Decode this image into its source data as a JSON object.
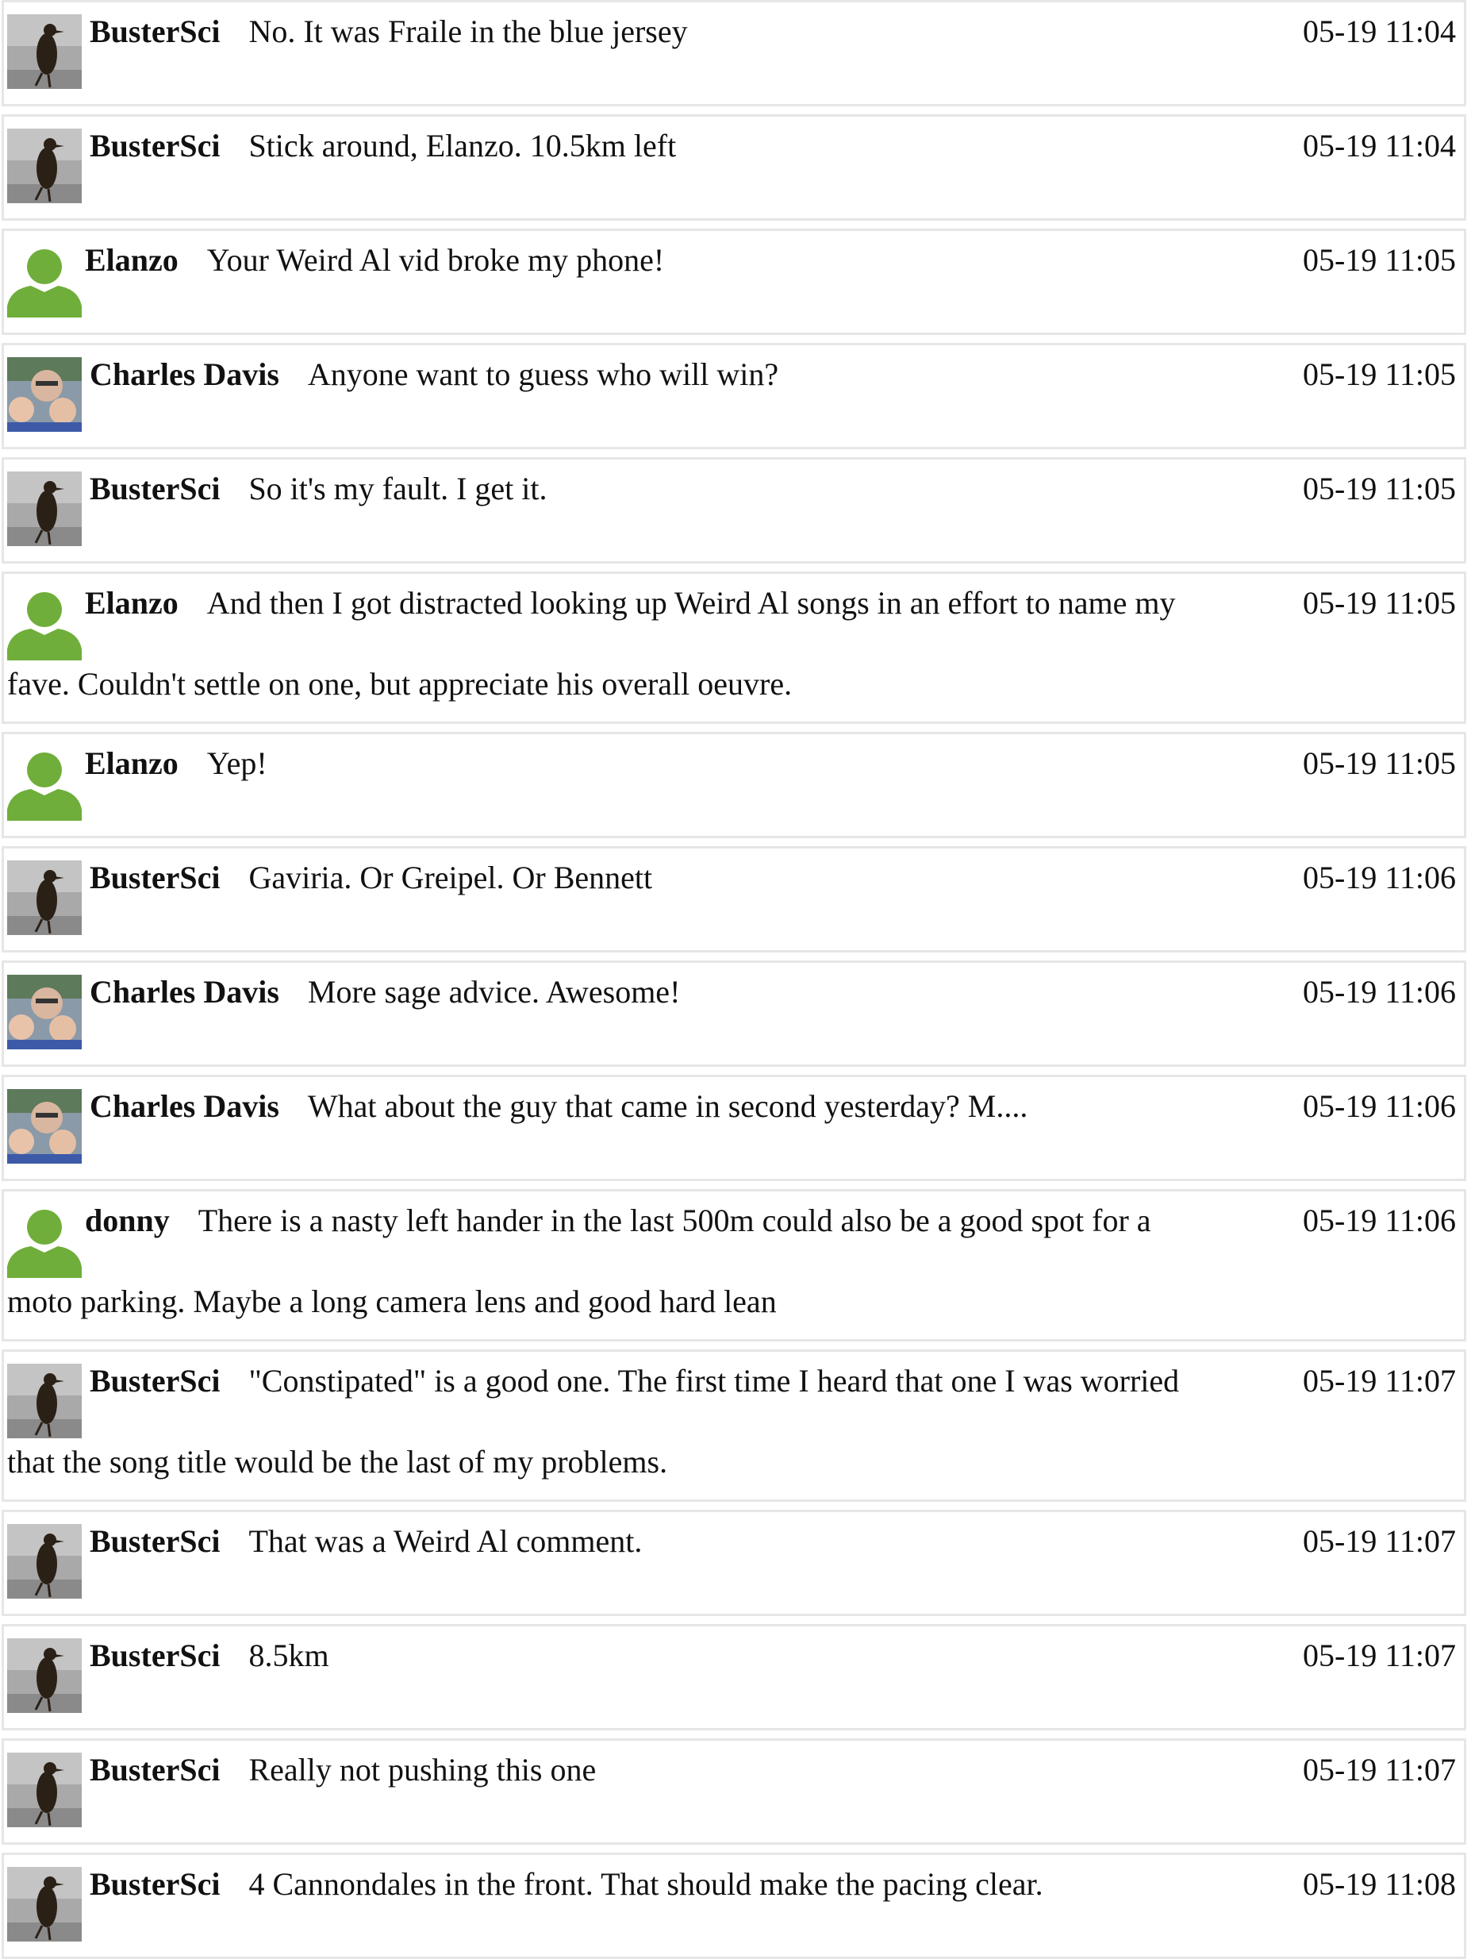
{
  "avatar_colors": {
    "default_user": "#6fae3a",
    "penguin_bg": "#a9a9a9",
    "family_bg": "#8a9aa8"
  },
  "messages": [
    {
      "author": "BusterSci",
      "avatar": "penguin-avatar",
      "text": "No. It was Fraile in the blue jersey",
      "cont": "",
      "time": "05-19 11:04"
    },
    {
      "author": "BusterSci",
      "avatar": "penguin-avatar",
      "text": "Stick around, Elanzo. 10.5km left",
      "cont": "",
      "time": "05-19 11:04"
    },
    {
      "author": "Elanzo",
      "avatar": "default-user-icon",
      "text": "Your Weird Al vid broke my phone!",
      "cont": "",
      "time": "05-19 11:05"
    },
    {
      "author": "Charles Davis",
      "avatar": "family-photo-avatar",
      "text": "Anyone want to guess who will win?",
      "cont": "",
      "time": "05-19 11:05"
    },
    {
      "author": "BusterSci",
      "avatar": "penguin-avatar",
      "text": "So it's my fault. I get it.",
      "cont": "",
      "time": "05-19 11:05"
    },
    {
      "author": "Elanzo",
      "avatar": "default-user-icon",
      "text": "And then I got distracted looking up Weird Al songs in an effort to name my",
      "cont": "fave. Couldn't settle on one, but appreciate his overall oeuvre.",
      "time": "05-19 11:05"
    },
    {
      "author": "Elanzo",
      "avatar": "default-user-icon",
      "text": "Yep!",
      "cont": "",
      "time": "05-19 11:05"
    },
    {
      "author": "BusterSci",
      "avatar": "penguin-avatar",
      "text": "Gaviria. Or Greipel. Or Bennett",
      "cont": "",
      "time": "05-19 11:06"
    },
    {
      "author": "Charles Davis",
      "avatar": "family-photo-avatar",
      "text": "More sage advice. Awesome!",
      "cont": "",
      "time": "05-19 11:06"
    },
    {
      "author": "Charles Davis",
      "avatar": "family-photo-avatar",
      "text": "What about the guy that came in second yesterday? M....",
      "cont": "",
      "time": "05-19 11:06"
    },
    {
      "author": "donny",
      "avatar": "default-user-icon",
      "text": "There is a nasty left hander in the last 500m could also be a good spot for a",
      "cont": "moto parking. Maybe a long camera lens and good hard lean",
      "time": "05-19 11:06"
    },
    {
      "author": "BusterSci",
      "avatar": "penguin-avatar",
      "text": "\"Constipated\" is a good one. The first time I heard that one I was worried",
      "cont": "that the song title would be the last of my problems.",
      "time": "05-19 11:07"
    },
    {
      "author": "BusterSci",
      "avatar": "penguin-avatar",
      "text": "That was a Weird Al comment.",
      "cont": "",
      "time": "05-19 11:07"
    },
    {
      "author": "BusterSci",
      "avatar": "penguin-avatar",
      "text": "8.5km",
      "cont": "",
      "time": "05-19 11:07"
    },
    {
      "author": "BusterSci",
      "avatar": "penguin-avatar",
      "text": "Really not pushing this one",
      "cont": "",
      "time": "05-19 11:07"
    },
    {
      "author": "BusterSci",
      "avatar": "penguin-avatar",
      "text": "4 Cannondales in the front. That should make the pacing clear.",
      "cont": "",
      "time": "05-19 11:08"
    }
  ]
}
